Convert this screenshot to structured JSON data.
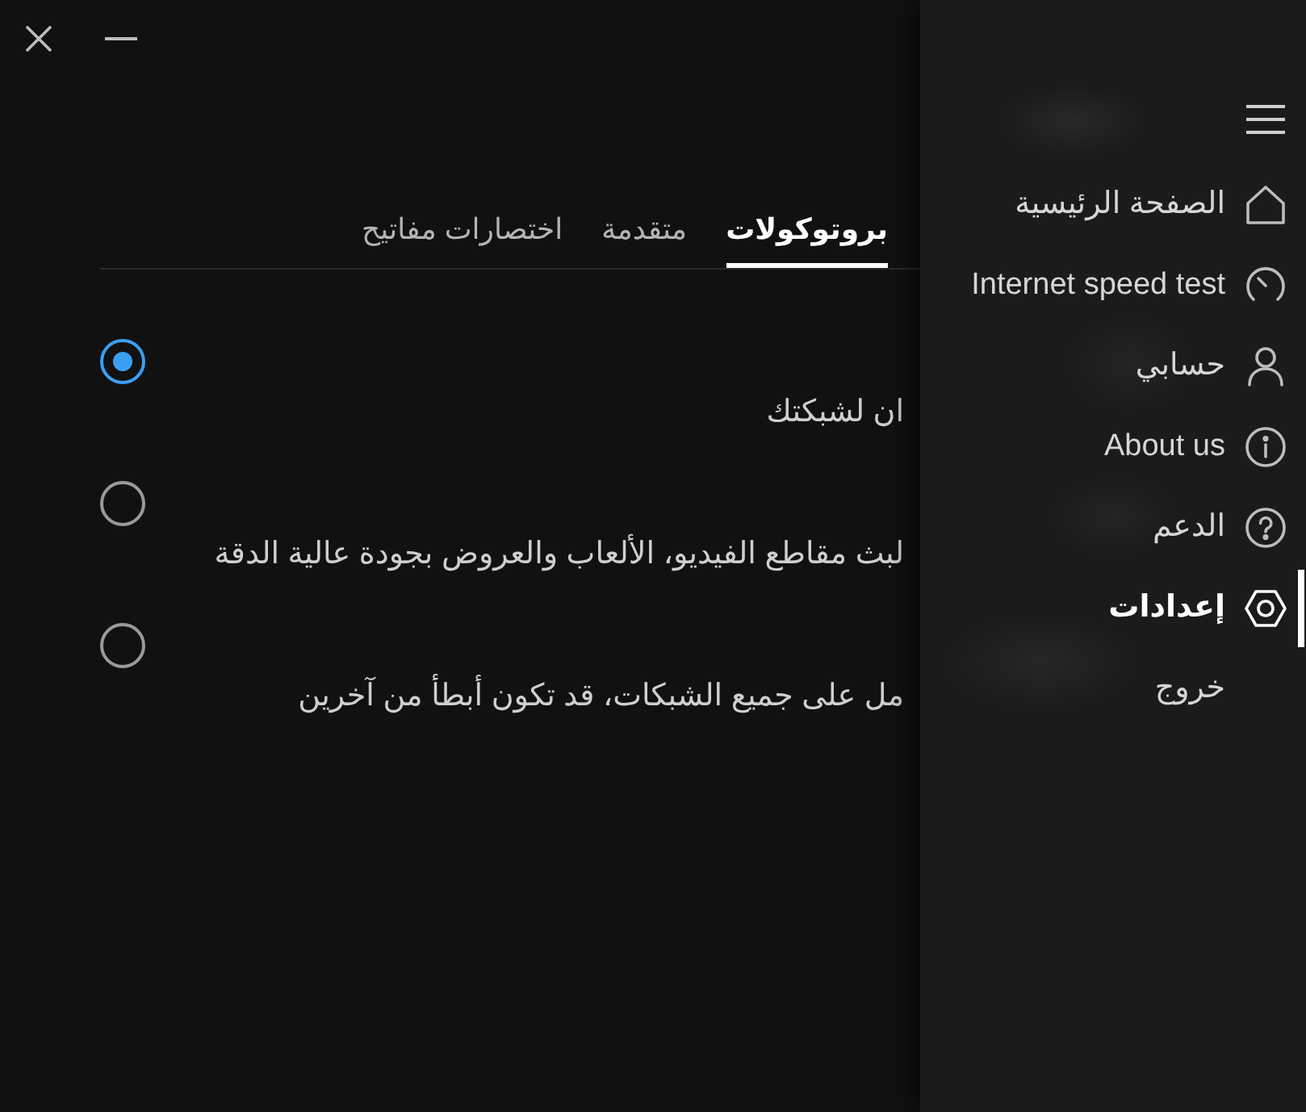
{
  "tabs": [
    {
      "label": "بروتوكولات",
      "selected": true
    },
    {
      "label": "متقدمة",
      "selected": false
    },
    {
      "label": "اختصارات مفاتيح",
      "selected": false
    }
  ],
  "options": [
    {
      "selected": true,
      "description": "ان لشبكتك"
    },
    {
      "selected": false,
      "description": "لبث مقاطع الفيديو، الألعاب والعروض بجودة عالية الدقة"
    },
    {
      "selected": false,
      "description": "مل على جميع الشبكات، قد تكون أبطأ من آخرين"
    }
  ],
  "sidebar": {
    "items": [
      {
        "label": "الصفحة الرئيسية",
        "selected": false
      },
      {
        "label": "Internet speed test",
        "selected": false
      },
      {
        "label": "حسابي",
        "selected": false
      },
      {
        "label": "About us",
        "selected": false
      },
      {
        "label": "الدعم",
        "selected": false
      },
      {
        "label": "إعدادات",
        "selected": true
      },
      {
        "label": "خروج",
        "selected": false
      }
    ]
  }
}
